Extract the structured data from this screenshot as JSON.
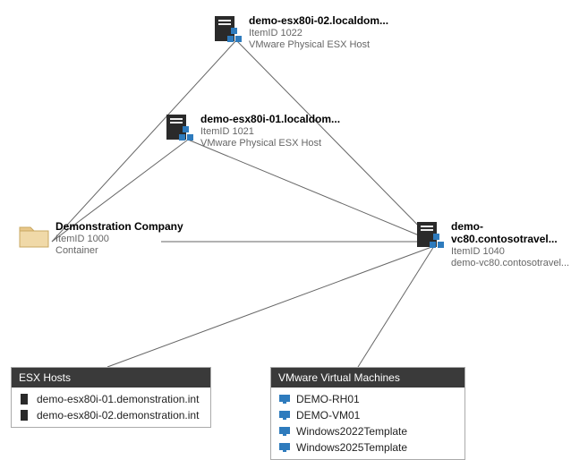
{
  "nodes": {
    "esx02": {
      "title": "demo-esx80i-02.localdom...",
      "itemid": "ItemID 1022",
      "desc": "VMware Physical ESX Host"
    },
    "esx01": {
      "title": "demo-esx80i-01.localdom...",
      "itemid": "ItemID 1021",
      "desc": "VMware Physical ESX Host"
    },
    "company": {
      "title": "Demonstration Company",
      "itemid": "ItemID 1000",
      "desc": "Container"
    },
    "vcenter": {
      "title": "demo-vc80.contosotravel...",
      "itemid": "ItemID 1040",
      "desc": "demo-vc80.contosotravel..."
    }
  },
  "panels": {
    "esxhosts": {
      "header": "ESX Hosts",
      "items": [
        "demo-esx80i-01.demonstration.int",
        "demo-esx80i-02.demonstration.int"
      ]
    },
    "vms": {
      "header": "VMware Virtual Machines",
      "items": [
        "DEMO-RH01",
        "DEMO-VM01",
        "Windows2022Template",
        "Windows2025Template"
      ]
    }
  }
}
